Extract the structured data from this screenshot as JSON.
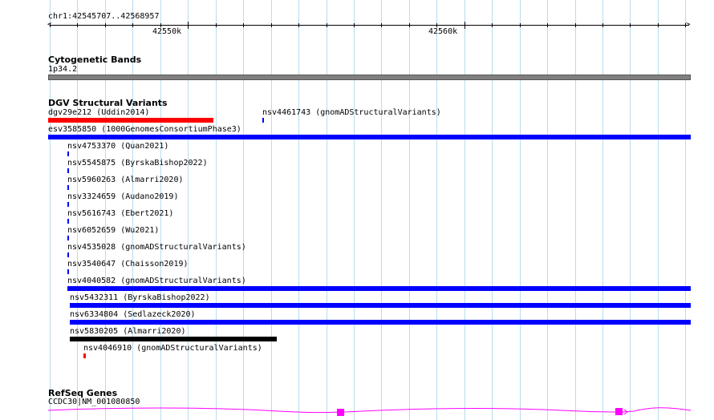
{
  "ruler": {
    "range_label": "chr1:42545707..42568957",
    "major_labels": [
      "42550k",
      "42560k"
    ]
  },
  "cytoband": {
    "title": "Cytogenetic Bands",
    "band_label": "1p34.2"
  },
  "dgv": {
    "title": "DGV Structural Variants",
    "variants": [
      {
        "label": "dgv29e212 (Uddin2014)",
        "color": "#ff0000"
      },
      {
        "label": "nsv4461743 (gnomADStructuralVariants)",
        "color": "#0000ff"
      },
      {
        "label": "esv3585850 (1000GenomesConsortiumPhase3)",
        "color": "#0000ff"
      },
      {
        "label": "nsv4753370 (Quan2021)",
        "color": "#0000ff"
      },
      {
        "label": "nsv5545875 (ByrskaBishop2022)",
        "color": "#0000ff"
      },
      {
        "label": "nsv5960263 (Almarri2020)",
        "color": "#0000ff"
      },
      {
        "label": "nsv3324659 (Audano2019)",
        "color": "#0000ff"
      },
      {
        "label": "nsv5616743 (Ebert2021)",
        "color": "#0000ff"
      },
      {
        "label": "nsv6052659 (Wu2021)",
        "color": "#0000ff"
      },
      {
        "label": "nsv4535028 (gnomADStructuralVariants)",
        "color": "#0000ff"
      },
      {
        "label": "nsv3540647 (Chaisson2019)",
        "color": "#0000ff"
      },
      {
        "label": "nsv4040582 (gnomADStructuralVariants)",
        "color": "#0000ff"
      },
      {
        "label": "nsv5432311 (ByrskaBishop2022)",
        "color": "#0000ff"
      },
      {
        "label": "nsv6334804 (Sedlazeck2020)",
        "color": "#0000ff"
      },
      {
        "label": "nsv5830205 (Almarri2020)",
        "color": "#000000"
      },
      {
        "label": "nsv4046910 (gnomADStructuralVariants)",
        "color": "#ff0000"
      }
    ]
  },
  "refseq": {
    "title": "RefSeq Genes",
    "gene_label": "CCDC30|NM_001080850",
    "gene_color": "#ff00ff"
  },
  "colors": {
    "grid": "#b8dcf0",
    "cytoband_fill": "#808080"
  }
}
